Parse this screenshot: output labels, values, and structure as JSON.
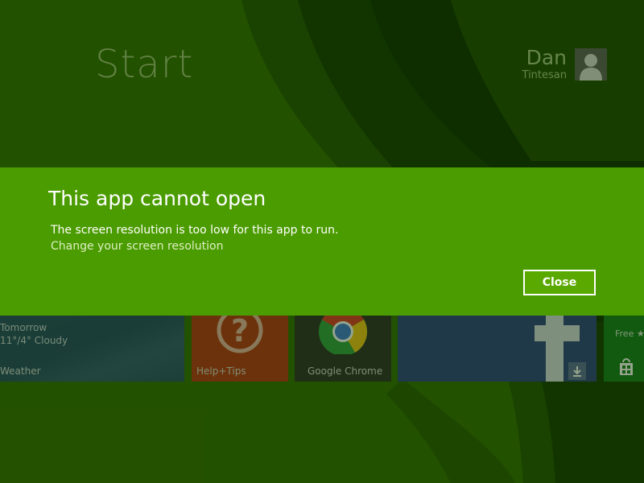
{
  "start": {
    "title": "Start"
  },
  "user": {
    "first_name": "Dan",
    "last_name": "Tintesan",
    "avatar_icon": "user-silhouette-icon"
  },
  "tiles": {
    "weather": {
      "line1": "Tomorrow",
      "line2": "11°/4° Cloudy",
      "label": "Weather"
    },
    "help": {
      "label": "Help+Tips",
      "icon": "question-mark-icon"
    },
    "chrome": {
      "label": "Google Chrome",
      "icon": "chrome-logo-icon"
    },
    "facebook": {
      "icon": "facebook-logo-icon",
      "badge_icon": "download-icon"
    },
    "store": {
      "label": "Free ★",
      "icon": "store-bag-icon"
    }
  },
  "dialog": {
    "title": "This app cannot open",
    "message": "The screen resolution is too low for this app to run.",
    "link": "Change your screen resolution",
    "close_label": "Close"
  },
  "colors": {
    "background": "#2f6a00",
    "dialog": "#4b9c00",
    "close_button": "#5aa900"
  }
}
